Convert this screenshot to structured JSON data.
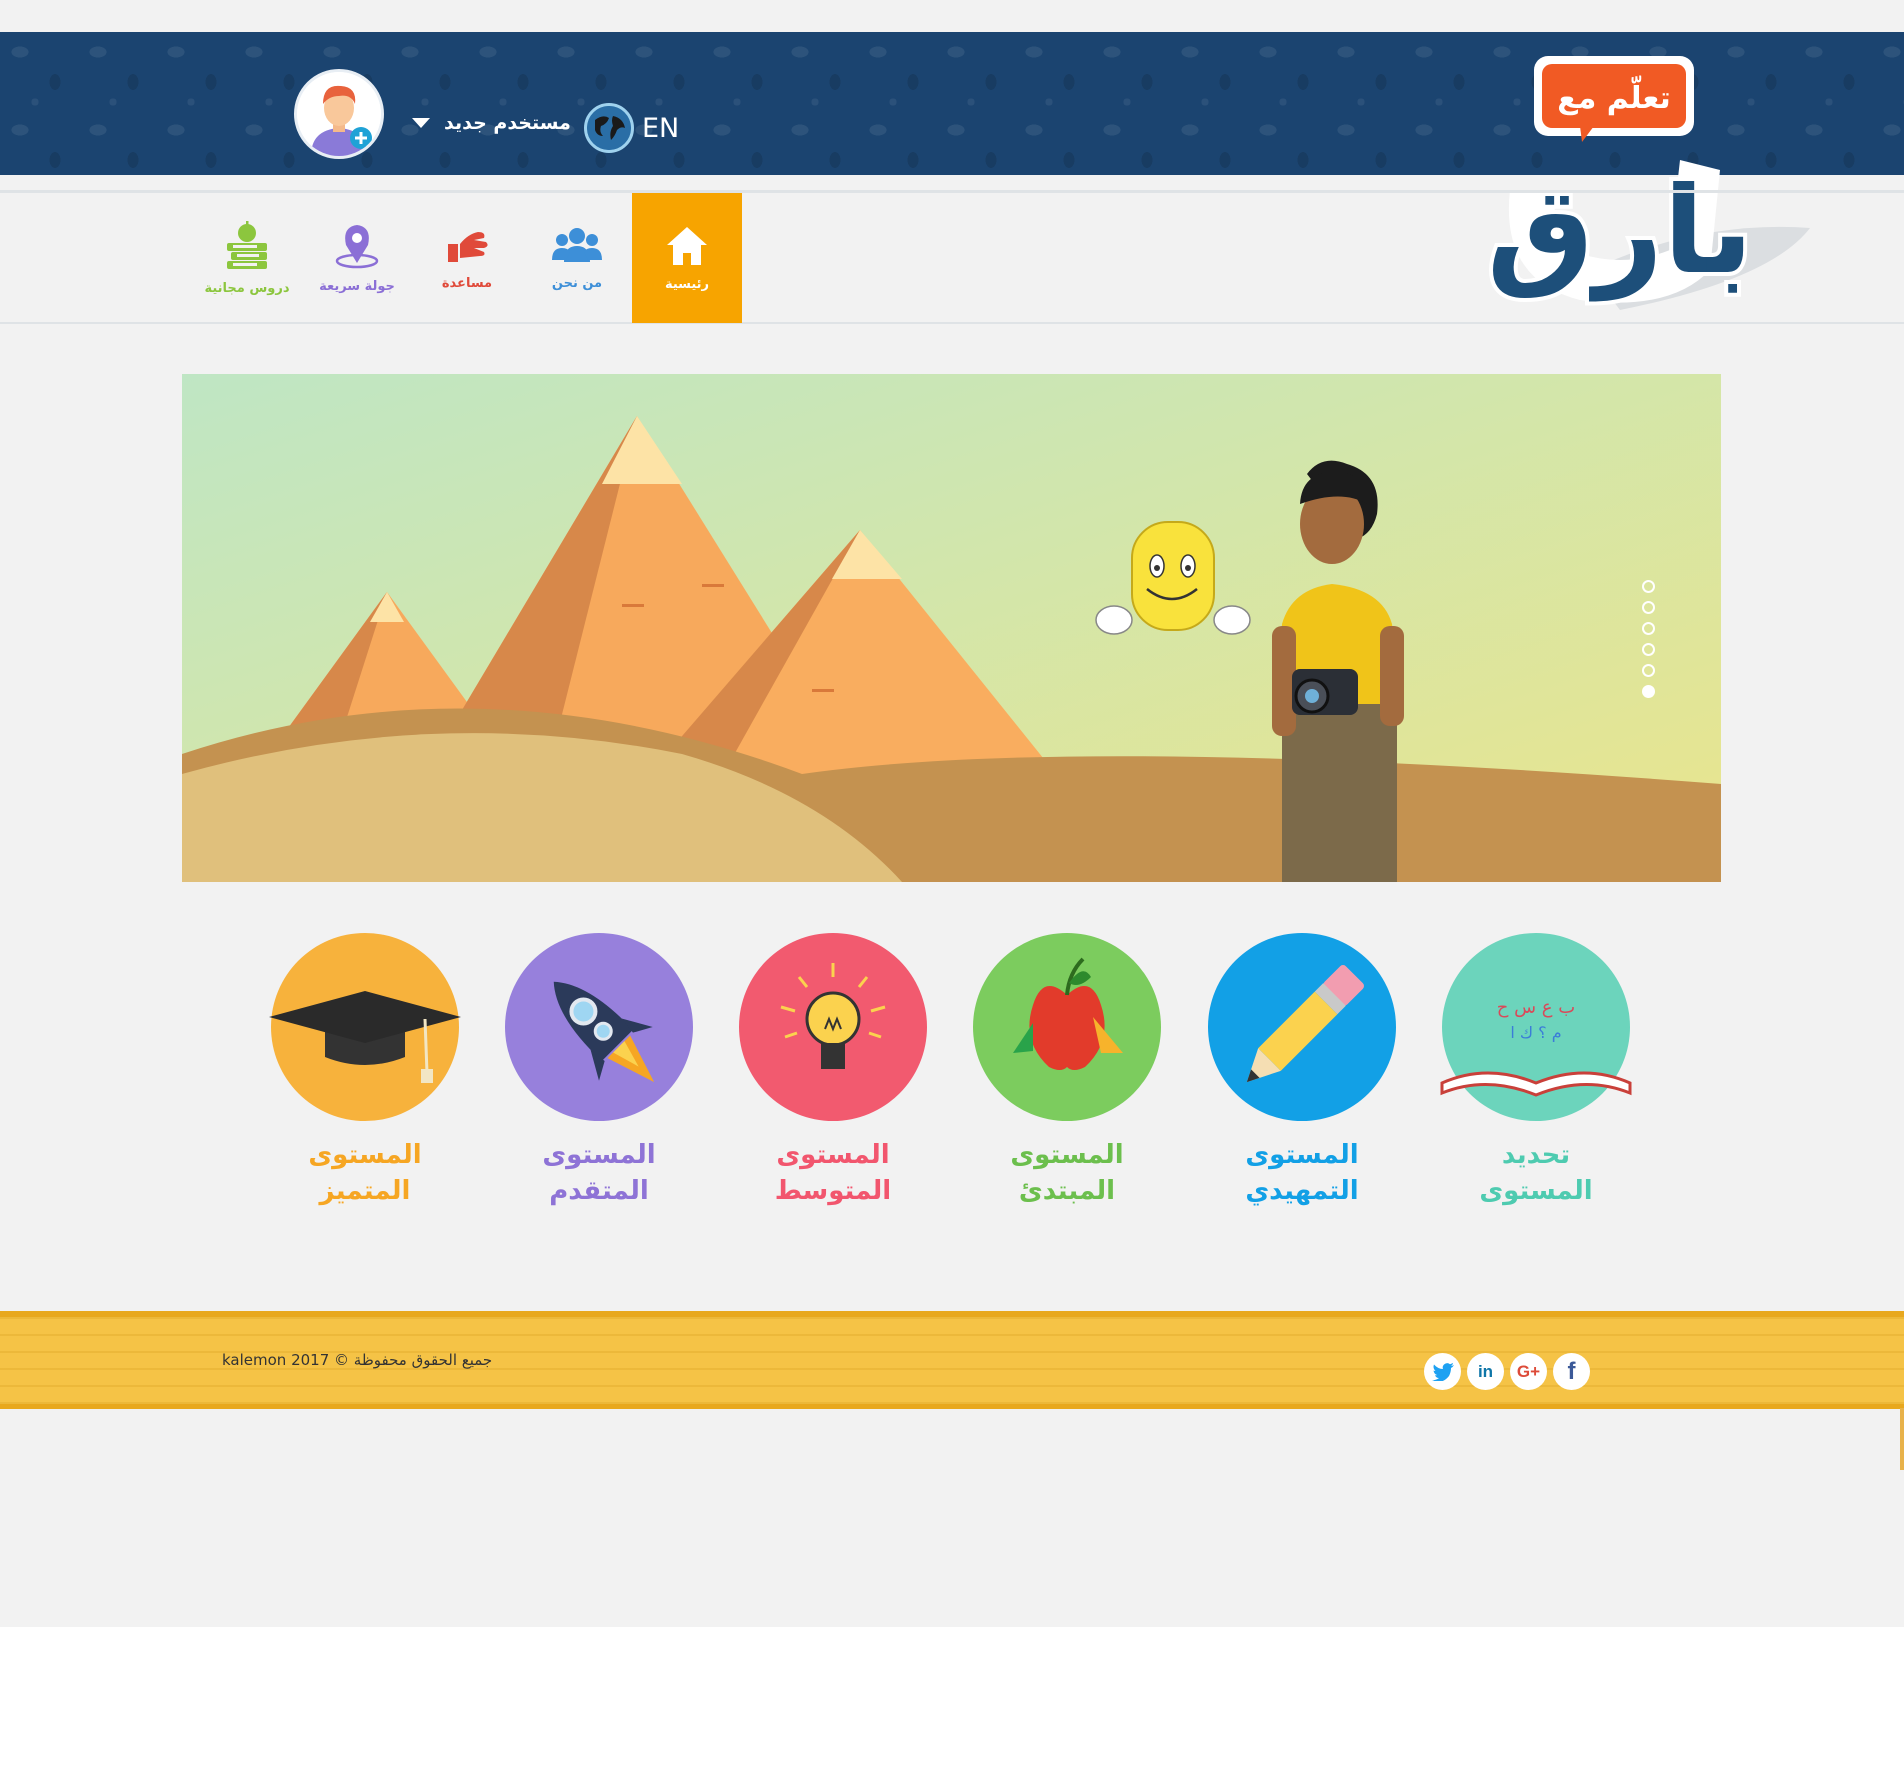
{
  "header": {
    "user_label": "مستخدم جديد",
    "language_label": "EN"
  },
  "logo": {
    "tagline": "تعلّم مع",
    "name": "بارق"
  },
  "nav": {
    "items": [
      {
        "label": "رئيسية",
        "icon": "home-icon",
        "color": "#ffffff",
        "active": true
      },
      {
        "label": "من نحن",
        "icon": "people-icon",
        "color": "#3d8fd8"
      },
      {
        "label": "مساعدة",
        "icon": "help-hand-icon",
        "color": "#e04a3a"
      },
      {
        "label": "جولة سريعة",
        "icon": "location-pin-icon",
        "color": "#8b6fd6"
      },
      {
        "label": "دروس مجانية",
        "icon": "books-apple-icon",
        "color": "#8cc63e"
      }
    ]
  },
  "slider": {
    "slide_count": 6,
    "active_index": 5
  },
  "levels": [
    {
      "label": "تحديد\nالمستوى",
      "icon": "open-book-letters-icon",
      "color": "#4ecbb0"
    },
    {
      "label": "المستوى\nالتمهيدي",
      "icon": "pencil-icon",
      "color": "#12a0e6"
    },
    {
      "label": "المستوى\nالمبتدئ",
      "icon": "apple-icon",
      "color": "#6cbf4d"
    },
    {
      "label": "المستوى\nالمتوسط",
      "icon": "light-bulb-icon",
      "color": "#f2566e"
    },
    {
      "label": "المستوى\nالمتقدم",
      "icon": "rocket-icon",
      "color": "#8e73d6"
    },
    {
      "label": "المستوى\nالمتميز",
      "icon": "graduation-cap-icon",
      "color": "#f6a623"
    }
  ],
  "footer": {
    "copyright": "جميع الحقوق محفوظة © kalemon 2017",
    "socials": [
      {
        "name": "facebook",
        "glyph": "f",
        "color": "#3b5998"
      },
      {
        "name": "google-plus",
        "glyph": "G+",
        "color": "#dd4b39"
      },
      {
        "name": "linkedin",
        "glyph": "in",
        "color": "#0e76a8"
      },
      {
        "name": "twitter",
        "glyph": "t",
        "color": "#1da1f2"
      }
    ]
  }
}
